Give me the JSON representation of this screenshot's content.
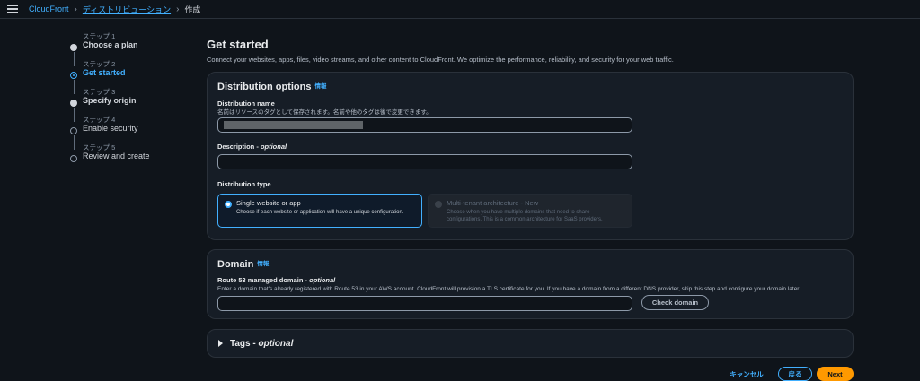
{
  "breadcrumb": {
    "items": [
      "CloudFront",
      "ディストリビューション"
    ],
    "current": "作成"
  },
  "steps": [
    {
      "num": "ステップ 1",
      "title": "Choose a plan",
      "state": "done"
    },
    {
      "num": "ステップ 2",
      "title": "Get started",
      "state": "current"
    },
    {
      "num": "ステップ 3",
      "title": "Specify origin",
      "state": "done"
    },
    {
      "num": "ステップ 4",
      "title": "Enable security",
      "state": "todo"
    },
    {
      "num": "ステップ 5",
      "title": "Review and create",
      "state": "todo"
    }
  ],
  "main": {
    "title": "Get started",
    "description": "Connect your websites, apps, files, video streams, and other content to CloudFront. We optimize the performance, reliability, and security for your web traffic."
  },
  "distribution_options": {
    "title": "Distribution options",
    "info": "情報",
    "name_label": "Distribution name",
    "name_hint": "名前はリソースのタグとして保存されます。名前や他のタグは後で変更できます。",
    "name_value": "",
    "description_label": "Description - ",
    "description_optional": "optional",
    "description_value": "",
    "type_label": "Distribution type",
    "types": [
      {
        "title": "Single website or app",
        "desc": "Choose if each website or application will have a unique configuration."
      },
      {
        "title": "Multi-tenant architecture - New",
        "desc": "Choose when you have multiple domains that need to share configurations. This is a common architecture for SaaS providers."
      }
    ]
  },
  "domain": {
    "title": "Domain",
    "info": "情報",
    "label": "Route 53 managed domain - ",
    "optional": "optional",
    "hint": "Enter a domain that's already registered with Route 53 in your AWS account. CloudFront will provision a TLS certificate for you. If you have a domain from a different DNS provider, skip this step and configure your domain later.",
    "value": "",
    "check_button": "Check domain"
  },
  "tags": {
    "title": "Tags - ",
    "optional": "optional"
  },
  "footer": {
    "cancel": "キャンセル",
    "back": "戻る",
    "next": "Next"
  },
  "colors": {
    "accent": "#42b0ff",
    "primary_button": "#ff9900",
    "background": "#0f141a",
    "panel": "#161d26"
  }
}
